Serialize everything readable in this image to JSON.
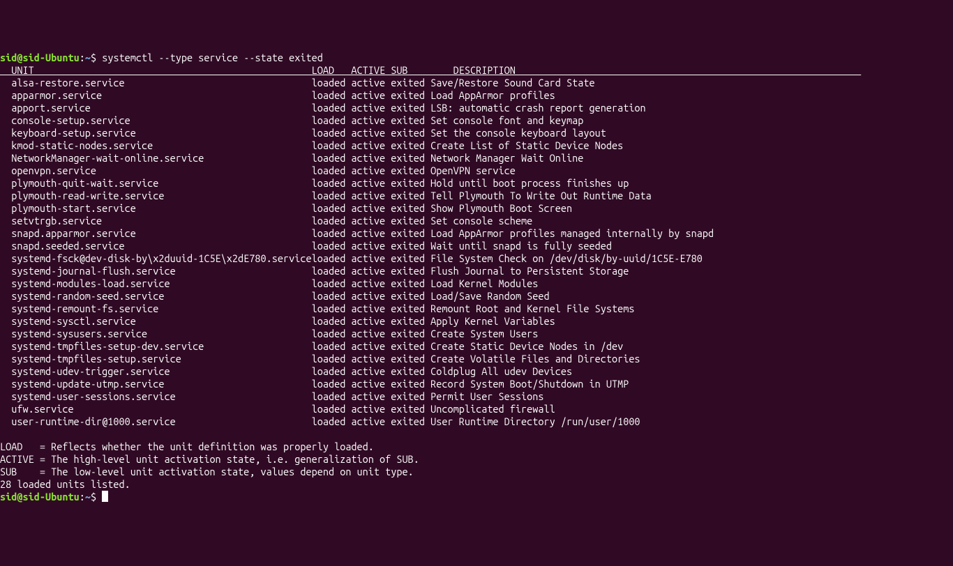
{
  "prompt": {
    "user": "sid",
    "at": "@",
    "host": "sid-Ubuntu",
    "colon": ":",
    "path": "~",
    "dollar": "$"
  },
  "command": "systemctl --type service --state exited",
  "header": {
    "unit": "UNIT",
    "load": "LOAD",
    "active": "ACTIVE",
    "sub": "SUB",
    "description": "DESCRIPTION"
  },
  "services": [
    {
      "unit": "alsa-restore.service",
      "load": "loaded",
      "active": "active",
      "sub": "exited",
      "desc": "Save/Restore Sound Card State"
    },
    {
      "unit": "apparmor.service",
      "load": "loaded",
      "active": "active",
      "sub": "exited",
      "desc": "Load AppArmor profiles"
    },
    {
      "unit": "apport.service",
      "load": "loaded",
      "active": "active",
      "sub": "exited",
      "desc": "LSB: automatic crash report generation"
    },
    {
      "unit": "console-setup.service",
      "load": "loaded",
      "active": "active",
      "sub": "exited",
      "desc": "Set console font and keymap"
    },
    {
      "unit": "keyboard-setup.service",
      "load": "loaded",
      "active": "active",
      "sub": "exited",
      "desc": "Set the console keyboard layout"
    },
    {
      "unit": "kmod-static-nodes.service",
      "load": "loaded",
      "active": "active",
      "sub": "exited",
      "desc": "Create List of Static Device Nodes"
    },
    {
      "unit": "NetworkManager-wait-online.service",
      "load": "loaded",
      "active": "active",
      "sub": "exited",
      "desc": "Network Manager Wait Online"
    },
    {
      "unit": "openvpn.service",
      "load": "loaded",
      "active": "active",
      "sub": "exited",
      "desc": "OpenVPN service"
    },
    {
      "unit": "plymouth-quit-wait.service",
      "load": "loaded",
      "active": "active",
      "sub": "exited",
      "desc": "Hold until boot process finishes up"
    },
    {
      "unit": "plymouth-read-write.service",
      "load": "loaded",
      "active": "active",
      "sub": "exited",
      "desc": "Tell Plymouth To Write Out Runtime Data"
    },
    {
      "unit": "plymouth-start.service",
      "load": "loaded",
      "active": "active",
      "sub": "exited",
      "desc": "Show Plymouth Boot Screen"
    },
    {
      "unit": "setvtrgb.service",
      "load": "loaded",
      "active": "active",
      "sub": "exited",
      "desc": "Set console scheme"
    },
    {
      "unit": "snapd.apparmor.service",
      "load": "loaded",
      "active": "active",
      "sub": "exited",
      "desc": "Load AppArmor profiles managed internally by snapd"
    },
    {
      "unit": "snapd.seeded.service",
      "load": "loaded",
      "active": "active",
      "sub": "exited",
      "desc": "Wait until snapd is fully seeded"
    },
    {
      "unit": "systemd-fsck@dev-disk-by\\x2duuid-1C5E\\x2dE780.service",
      "load": "loaded",
      "active": "active",
      "sub": "exited",
      "desc": "File System Check on /dev/disk/by-uuid/1C5E-E780"
    },
    {
      "unit": "systemd-journal-flush.service",
      "load": "loaded",
      "active": "active",
      "sub": "exited",
      "desc": "Flush Journal to Persistent Storage"
    },
    {
      "unit": "systemd-modules-load.service",
      "load": "loaded",
      "active": "active",
      "sub": "exited",
      "desc": "Load Kernel Modules"
    },
    {
      "unit": "systemd-random-seed.service",
      "load": "loaded",
      "active": "active",
      "sub": "exited",
      "desc": "Load/Save Random Seed"
    },
    {
      "unit": "systemd-remount-fs.service",
      "load": "loaded",
      "active": "active",
      "sub": "exited",
      "desc": "Remount Root and Kernel File Systems"
    },
    {
      "unit": "systemd-sysctl.service",
      "load": "loaded",
      "active": "active",
      "sub": "exited",
      "desc": "Apply Kernel Variables"
    },
    {
      "unit": "systemd-sysusers.service",
      "load": "loaded",
      "active": "active",
      "sub": "exited",
      "desc": "Create System Users"
    },
    {
      "unit": "systemd-tmpfiles-setup-dev.service",
      "load": "loaded",
      "active": "active",
      "sub": "exited",
      "desc": "Create Static Device Nodes in /dev"
    },
    {
      "unit": "systemd-tmpfiles-setup.service",
      "load": "loaded",
      "active": "active",
      "sub": "exited",
      "desc": "Create Volatile Files and Directories"
    },
    {
      "unit": "systemd-udev-trigger.service",
      "load": "loaded",
      "active": "active",
      "sub": "exited",
      "desc": "Coldplug All udev Devices"
    },
    {
      "unit": "systemd-update-utmp.service",
      "load": "loaded",
      "active": "active",
      "sub": "exited",
      "desc": "Record System Boot/Shutdown in UTMP"
    },
    {
      "unit": "systemd-user-sessions.service",
      "load": "loaded",
      "active": "active",
      "sub": "exited",
      "desc": "Permit User Sessions"
    },
    {
      "unit": "ufw.service",
      "load": "loaded",
      "active": "active",
      "sub": "exited",
      "desc": "Uncomplicated firewall"
    },
    {
      "unit": "user-runtime-dir@1000.service",
      "load": "loaded",
      "active": "active",
      "sub": "exited",
      "desc": "User Runtime Directory /run/user/1000"
    }
  ],
  "legend": {
    "load": "LOAD   = Reflects whether the unit definition was properly loaded.",
    "active": "ACTIVE = The high-level unit activation state, i.e. generalization of SUB.",
    "sub": "SUB    = The low-level unit activation state, values depend on unit type."
  },
  "summary": "28 loaded units listed.",
  "cols": {
    "indent": 2,
    "unit": 53,
    "load": 7,
    "active": 7,
    "sub": 7,
    "desc_offset_in_header": 11
  }
}
